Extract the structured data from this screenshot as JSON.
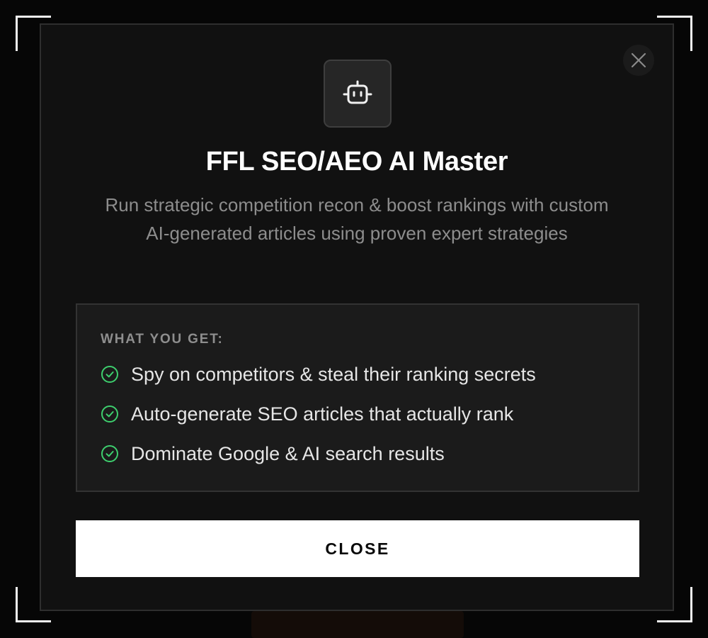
{
  "modal": {
    "title": "FFL SEO/AEO AI Master",
    "subtitle": "Run strategic competition recon & boost rankings with custom AI-generated articles using proven expert strategies",
    "icon": "robot-icon",
    "close_icon": "close-icon",
    "features": {
      "heading": "WHAT YOU GET:",
      "check_icon": "check-circle-icon",
      "items": [
        "Spy on competitors & steal their ranking secrets",
        "Auto-generate SEO articles that actually rank",
        "Dominate Google & AI search results"
      ]
    },
    "close_button_label": "CLOSE"
  },
  "colors": {
    "background": "#050505",
    "modal_bg": "#111111",
    "accent_check": "#3ecf6e",
    "button_bg": "#ffffff"
  }
}
